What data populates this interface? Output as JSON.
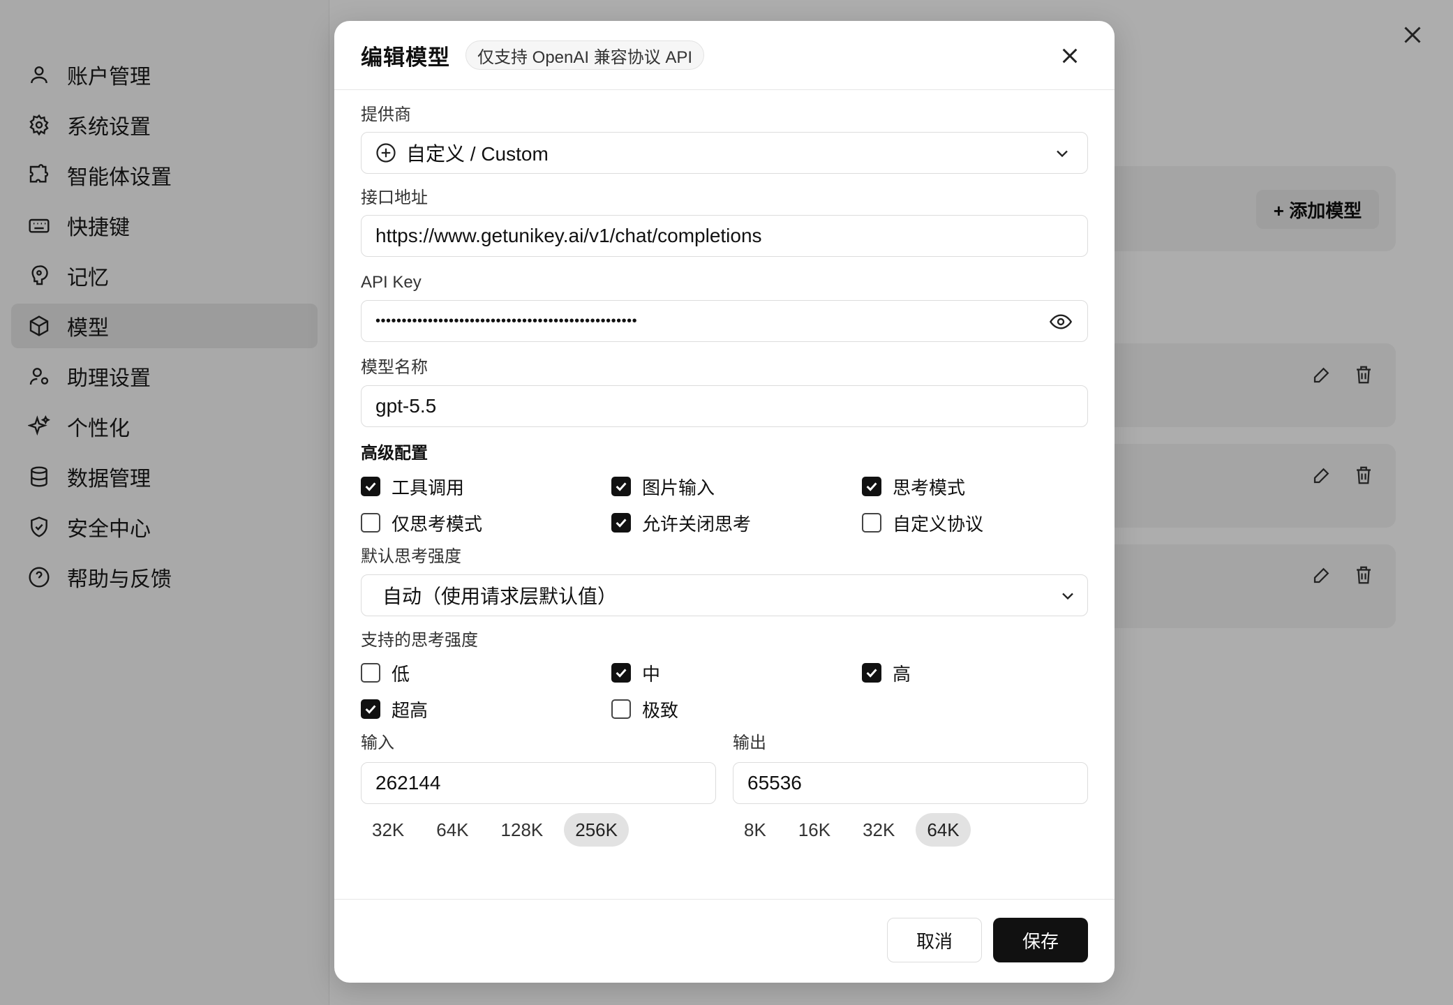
{
  "sidebar": {
    "items": [
      {
        "label": "账户管理",
        "icon": "user-icon"
      },
      {
        "label": "系统设置",
        "icon": "gear-icon"
      },
      {
        "label": "智能体设置",
        "icon": "puzzle-icon"
      },
      {
        "label": "快捷键",
        "icon": "keyboard-icon"
      },
      {
        "label": "记忆",
        "icon": "brain-icon"
      },
      {
        "label": "模型",
        "icon": "cube-icon",
        "active": true
      },
      {
        "label": "助理设置",
        "icon": "user-settings-icon"
      },
      {
        "label": "个性化",
        "icon": "sparkles-icon"
      },
      {
        "label": "数据管理",
        "icon": "database-icon"
      },
      {
        "label": "安全中心",
        "icon": "shield-icon"
      },
      {
        "label": "帮助与反馈",
        "icon": "help-icon"
      }
    ]
  },
  "main": {
    "add_model_label": "+ 添加模型"
  },
  "modal": {
    "title": "编辑模型",
    "badge": "仅支持 OpenAI 兼容协议 API",
    "provider": {
      "label": "提供商",
      "value": "自定义 / Custom"
    },
    "endpoint": {
      "label": "接口地址",
      "value": "https://www.getunikey.ai/v1/chat/completions"
    },
    "api_key": {
      "label": "API Key",
      "value": "••••••••••••••••••••••••••••••••••••••••••••••••••"
    },
    "model_name": {
      "label": "模型名称",
      "value": "gpt-5.5"
    },
    "advanced": {
      "label": "高级配置",
      "options": [
        {
          "label": "工具调用",
          "checked": true
        },
        {
          "label": "图片输入",
          "checked": true
        },
        {
          "label": "思考模式",
          "checked": true
        },
        {
          "label": "仅思考模式",
          "checked": false
        },
        {
          "label": "允许关闭思考",
          "checked": true
        },
        {
          "label": "自定义协议",
          "checked": false
        }
      ]
    },
    "default_effort": {
      "label": "默认思考强度",
      "value": "自动（使用请求层默认值）"
    },
    "supported_effort": {
      "label": "支持的思考强度",
      "options": [
        {
          "label": "低",
          "checked": false
        },
        {
          "label": "中",
          "checked": true
        },
        {
          "label": "高",
          "checked": true
        },
        {
          "label": "超高",
          "checked": true
        },
        {
          "label": "极致",
          "checked": false
        }
      ]
    },
    "input": {
      "label": "输入",
      "value": "262144",
      "presets": [
        "32K",
        "64K",
        "128K",
        "256K"
      ],
      "selected": "256K"
    },
    "output": {
      "label": "输出",
      "value": "65536",
      "presets": [
        "8K",
        "16K",
        "32K",
        "64K"
      ],
      "selected": "64K"
    },
    "cancel_label": "取消",
    "save_label": "保存"
  }
}
